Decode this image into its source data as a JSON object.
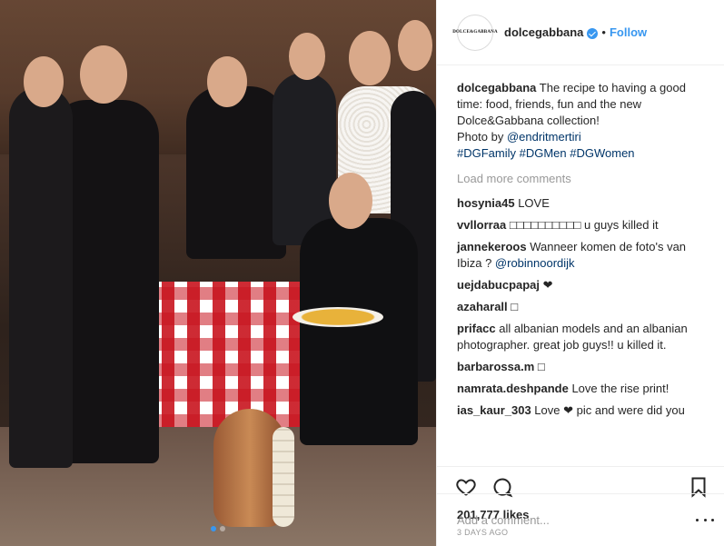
{
  "header": {
    "avatar_text": "DOLCE&GABBANA",
    "username": "dolcegabbana",
    "separator": "•",
    "follow_label": "Follow"
  },
  "caption": {
    "username": "dolcegabbana",
    "text": " The recipe to having a good time: food, friends, fun and the new Dolce&Gabbana collection!",
    "photo_by_prefix": "Photo by ",
    "photo_by_handle": "@endritmertiri",
    "hashtags": "#DGFamily #DGMen #DGWomen"
  },
  "load_more_label": "Load more comments",
  "comments": [
    {
      "user": "hosynia45",
      "text": " LOVE",
      "mention": ""
    },
    {
      "user": "vvllorraa",
      "text": " □□□□□□□□□□ u guys killed it",
      "mention": ""
    },
    {
      "user": "jannekeroos",
      "text": " Wanneer komen de foto's van Ibiza ? ",
      "mention": "@robinnoordijk"
    },
    {
      "user": "uejdabucpapaj",
      "text": " ❤",
      "mention": ""
    },
    {
      "user": "azaharall",
      "text": " □",
      "mention": ""
    },
    {
      "user": "prifacc",
      "text": " all albanian models and an albanian photographer. great job guys!! u killed it.",
      "mention": ""
    },
    {
      "user": "barbarossa.m",
      "text": " □",
      "mention": ""
    },
    {
      "user": "namrata.deshpande",
      "text": " Love the rise print!",
      "mention": ""
    },
    {
      "user": "ias_kaur_303",
      "text": " Love ❤ pic and were did you",
      "mention": ""
    }
  ],
  "likes_text": "201,777 likes",
  "time_text": "3 DAYS AGO",
  "add_comment_placeholder": "Add a comment...",
  "carousel": {
    "count": 2,
    "active_index": 0
  },
  "colors": {
    "link": "#003569",
    "follow": "#3897f0",
    "muted": "#999999"
  },
  "icons": {
    "like": "heart-icon",
    "comment": "comment-icon",
    "save": "bookmark-icon",
    "more": "more-options-icon",
    "verified": "verified-badge-icon"
  }
}
